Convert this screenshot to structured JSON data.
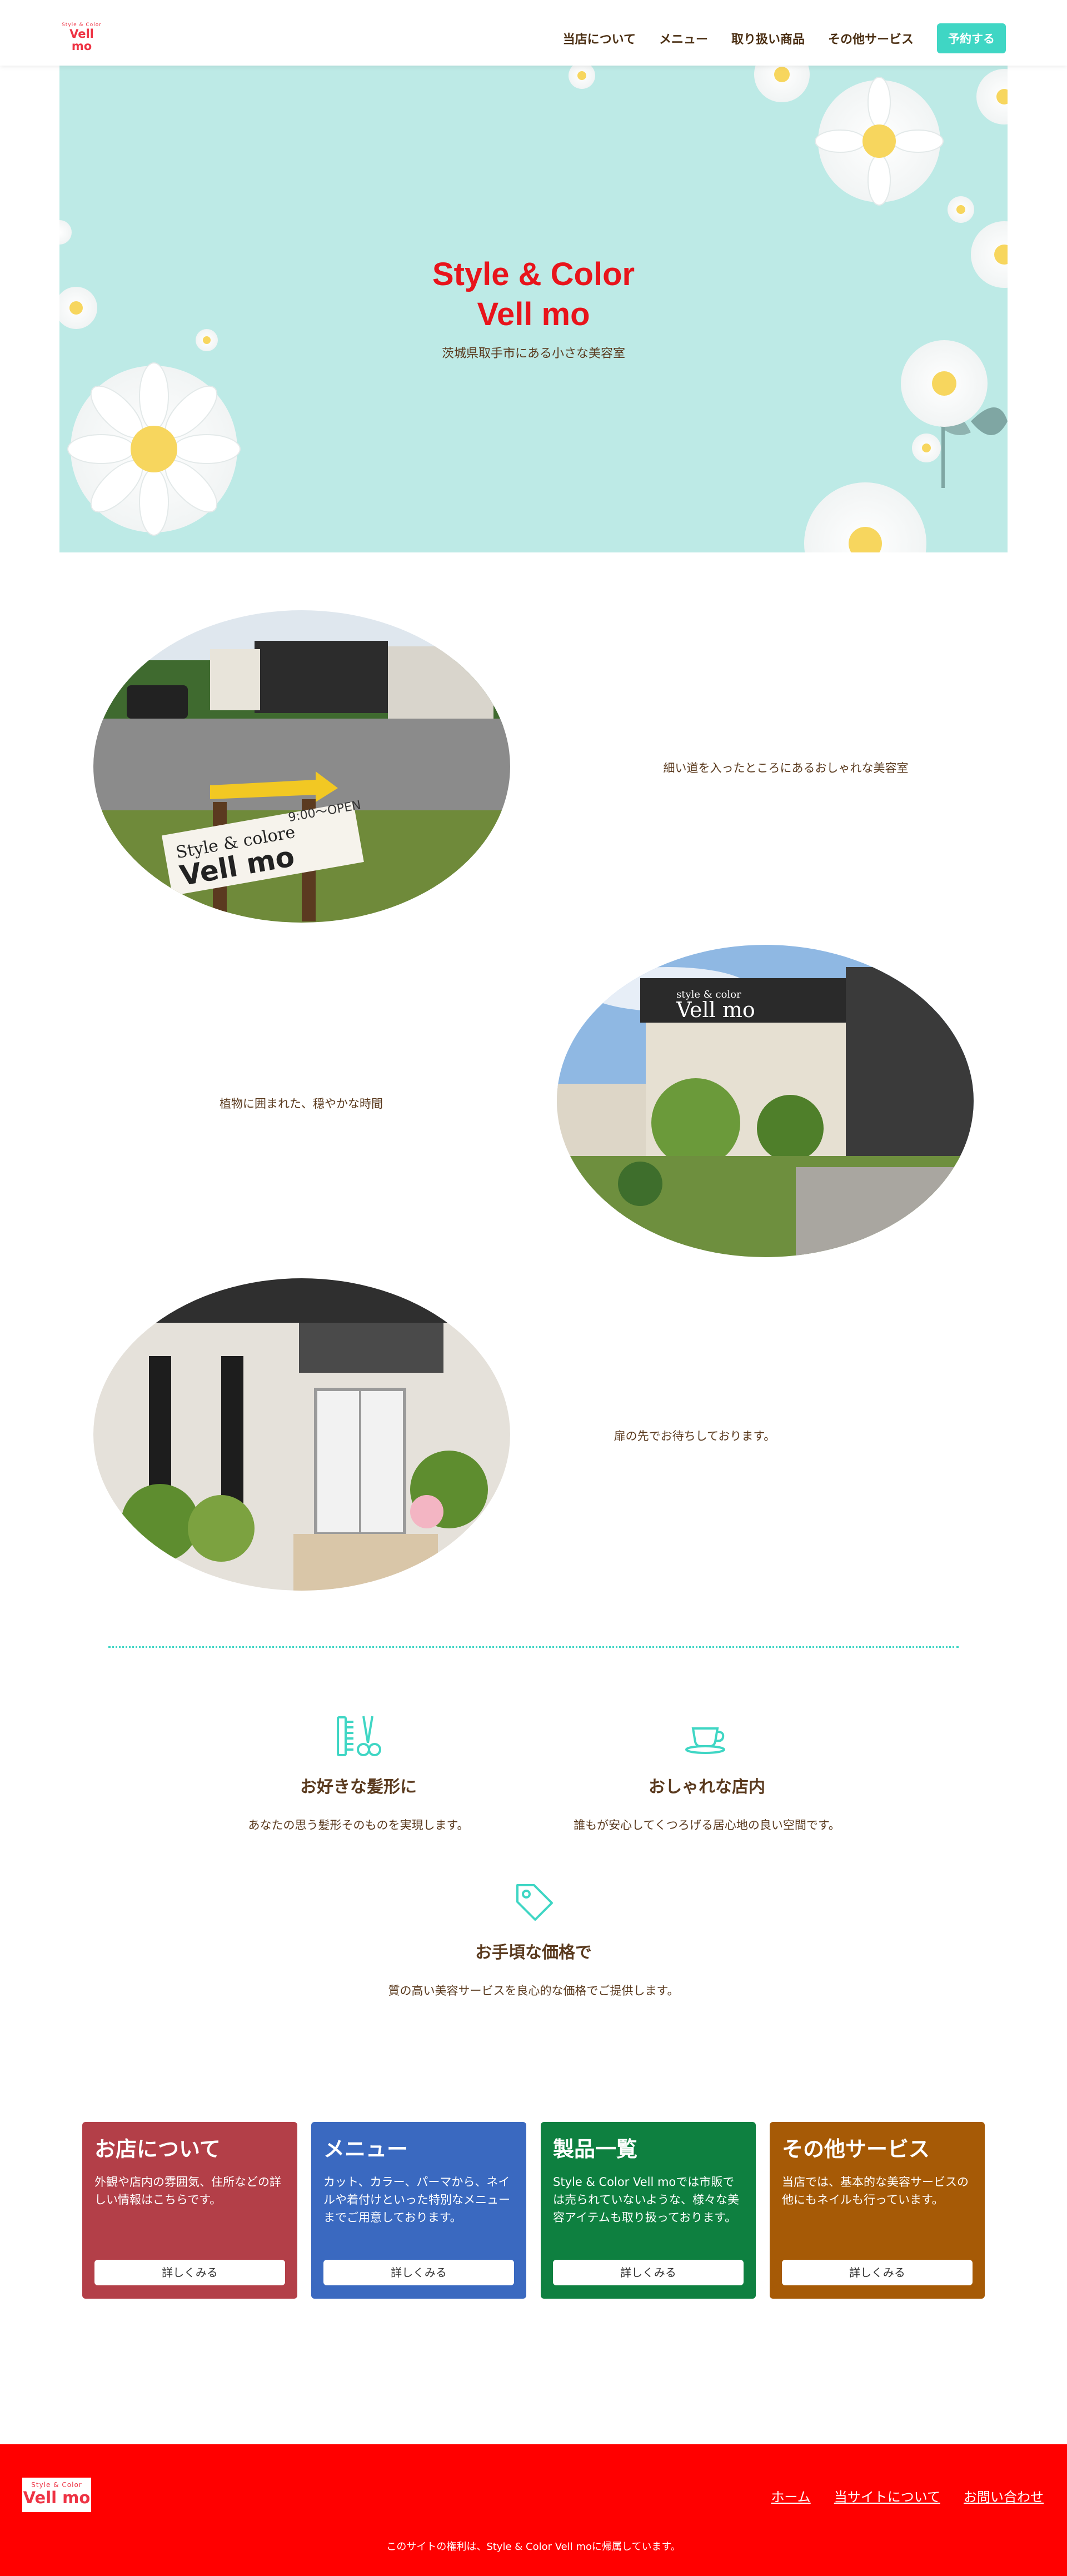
{
  "header": {
    "logo_small": "Style & Color",
    "logo_big": "Vell mo",
    "nav": [
      "当店について",
      "メニュー",
      "取り扱い商品",
      "その他サービス"
    ],
    "cta": "予約する"
  },
  "hero": {
    "title_line1": "Style & Color",
    "title_line2": "Vell mo",
    "subtitle": "茨城県取手市にある小さな美容室"
  },
  "features": [
    {
      "caption": "細い道を入ったところにあるおしゃれな美容室",
      "sign_line1": "Style & colore",
      "sign_line2": "Vell mo",
      "sign_open": "9:00〜OPEN"
    },
    {
      "caption": "植物に囲まれた、穏やかな時間",
      "shop_sign_small": "style & color",
      "shop_sign_big": "Vell mo"
    },
    {
      "caption": "扉の先でお待ちしております。"
    }
  ],
  "services": [
    {
      "icon": "comb-scissors-icon",
      "title": "お好きな髪形に",
      "desc": "あなたの思う髪形そのものを実現します。"
    },
    {
      "icon": "coffee-cup-icon",
      "title": "おしゃれな店内",
      "desc": "誰もが安心してくつろげる居心地の良い空間です。"
    },
    {
      "icon": "price-tag-icon",
      "title": "お手頃な価格で",
      "desc": "質の高い美容サービスを良心的な価格でご提供します。"
    }
  ],
  "cards": [
    {
      "title": "お店について",
      "body": "外観や店内の雰囲気、住所などの詳しい情報はこちらです。",
      "button": "詳しくみる",
      "color": "#b33f48"
    },
    {
      "title": "メニュー",
      "body": "カット、カラー、パーマから、ネイルや着付けといった特別なメニューまでご用意しております。",
      "button": "詳しくみる",
      "color": "#3a69c0"
    },
    {
      "title": "製品一覧",
      "body": "Style & Color Vell moでは市販では売られていないような、様々な美容アイテムも取り扱っております。",
      "button": "詳しくみる",
      "color": "#0e8040"
    },
    {
      "title": "その他サービス",
      "body": "当店では、基本的な美容サービスの他にもネイルも行っています。",
      "button": "詳しくみる",
      "color": "#a65a06"
    }
  ],
  "footer": {
    "logo_small": "Style & Color",
    "logo_big": "Vell mo",
    "links": [
      "ホーム",
      "当サイトについて",
      "お問い合わせ"
    ],
    "copyright": "このサイトの権利は、Style & Color Vell moに帰属しています。"
  },
  "colors": {
    "accent": "#3fd6c4",
    "hero_bg": "#bdeae6",
    "brand_red": "#e8141b",
    "footer_bg": "#ff0000",
    "text_brown": "#5a3a1e"
  }
}
